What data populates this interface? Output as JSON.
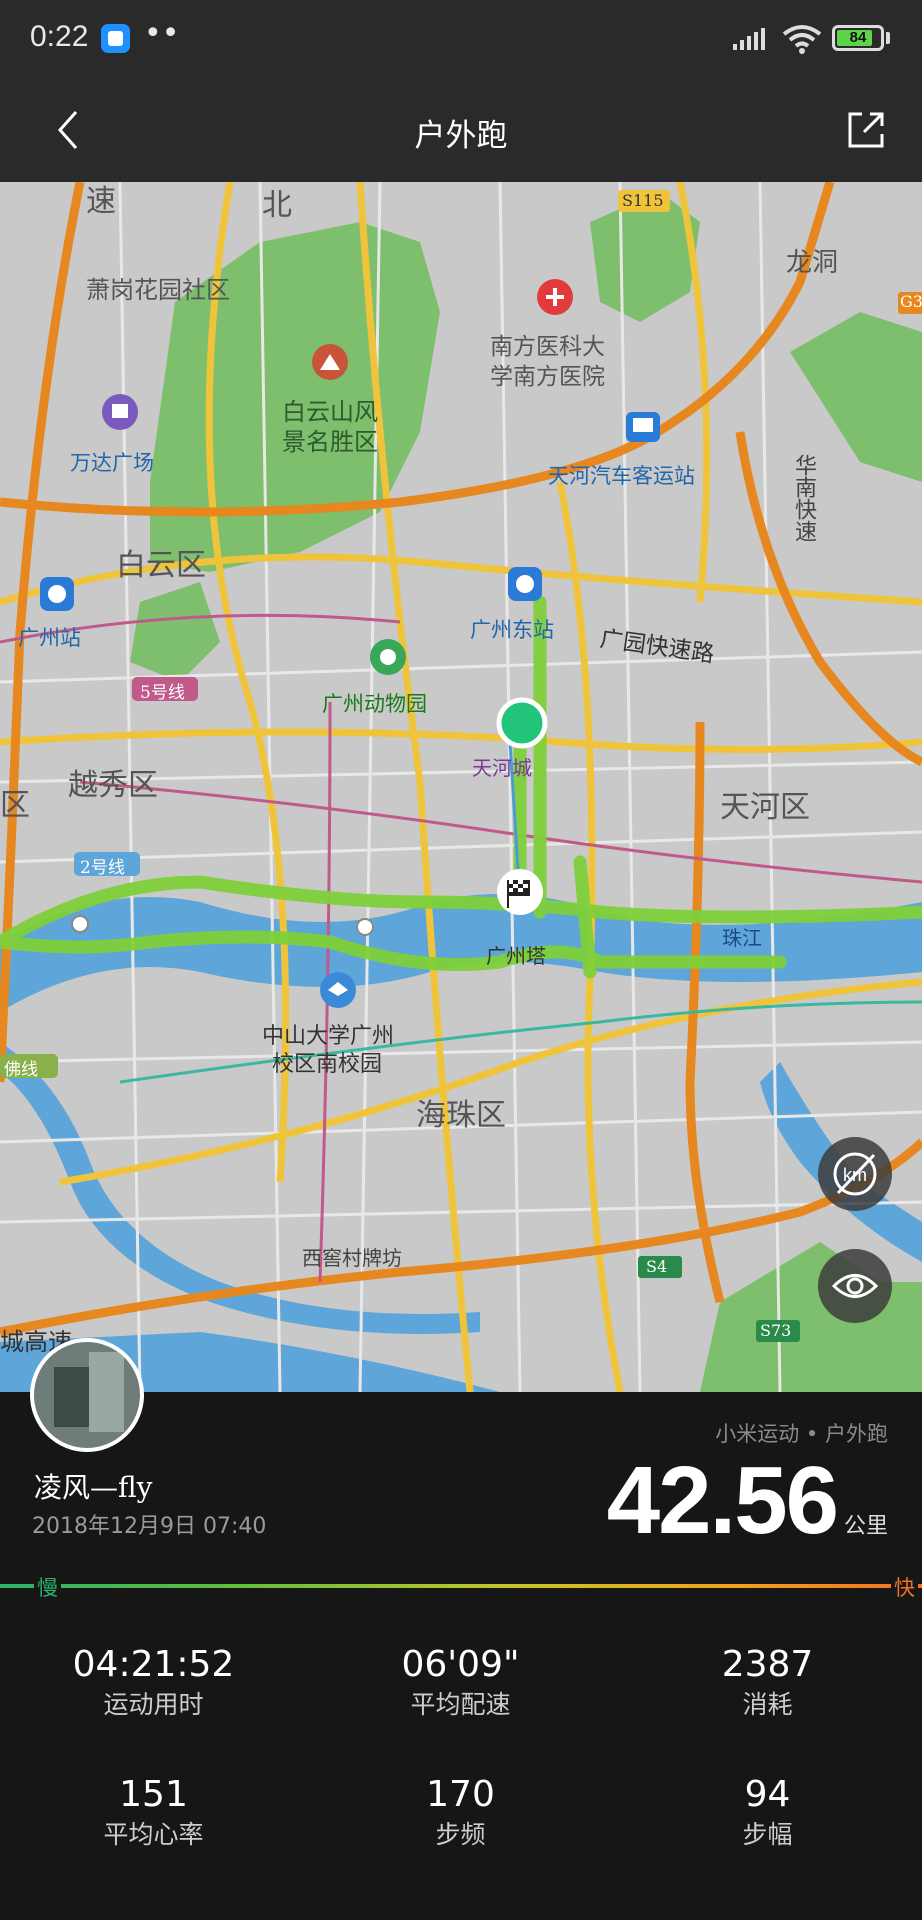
{
  "status_bar": {
    "time": "0:22",
    "app_icon": "app-notification-icon",
    "dots": "••",
    "battery": 84,
    "battery_text": "84"
  },
  "header": {
    "title": "户外跑",
    "back_icon": "chevron-left-icon",
    "share_icon": "share-icon"
  },
  "map": {
    "labels": {
      "su": "速",
      "bei": "北",
      "s115": "S115",
      "longdong": "龙洞",
      "g3": "G3",
      "xiaogang": "萧岗花园社区",
      "hospital1": "南方医科大",
      "hospital2": "学南方医院",
      "baiyun1": "白云山风",
      "baiyun2": "景名胜区",
      "wanda": "万达广场",
      "tianhe_bus": "天河汽车客运站",
      "huanan_kuaisu": "华南快速",
      "baiyun_qu": "白云区",
      "gz_station": "广州站",
      "gz_east": "广州东站",
      "guangyuan": "广园快速路",
      "line5": "5号线",
      "zoo": "广州动物园",
      "tianhe_park": "天河城",
      "qu_left": "区",
      "yuexiu": "越秀区",
      "tianhe_qu": "天河区",
      "line2": "2号线",
      "zhujiang": "珠江",
      "canton_tower": "广州塔",
      "fo_line": "佛线",
      "sysu1": "中山大学广州",
      "sysu2": "校区南校园",
      "haizhu": "海珠区",
      "xijiao": "西窖村牌坊",
      "s4": "S4",
      "s73": "S73",
      "chenggao": "城高速"
    },
    "controls": [
      "km-toggle-icon",
      "eye-icon"
    ]
  },
  "activity": {
    "username": "凌风—fly",
    "datetime": "2018年12月9日  07:40",
    "source": "小米运动 • 户外跑",
    "distance": "42.56",
    "distance_unit": "公里",
    "speed_slow": "慢",
    "speed_fast": "快"
  },
  "stats": [
    {
      "value": "04:21:52",
      "label": "运动用时"
    },
    {
      "value": "06'09\"",
      "label": "平均配速"
    },
    {
      "value": "2387",
      "label": "消耗"
    },
    {
      "value": "151",
      "label": "平均心率"
    },
    {
      "value": "170",
      "label": "步频"
    },
    {
      "value": "94",
      "label": "步幅"
    }
  ],
  "colors": {
    "background": "#161616",
    "header": "#2a2a2a",
    "route": "#7fd03a",
    "start_marker": "#22c47a",
    "slow": "#2ab36b",
    "fast": "#f07020"
  }
}
